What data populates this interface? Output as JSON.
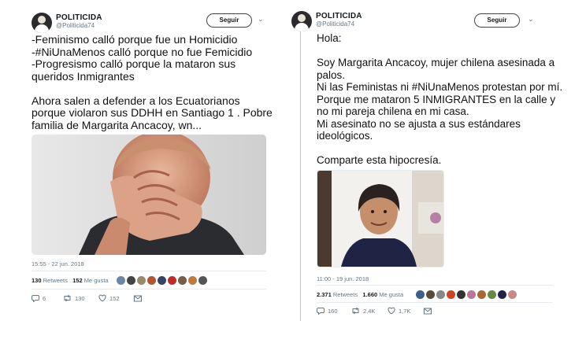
{
  "tweets": [
    {
      "name": "POLITICIDA",
      "handle": "@Politicida74",
      "follow": "Seguir",
      "text": "-Feminismo calló porque fue un Homicidio\n-#NiUnaMenos calló porque no fue Femicidio\n-Progresismo calló porque la mataron sus queridos Inmigrantes\n\nAhora salen a defender a los Ecuatorianos porque violaron sus DDHH en Santiago 1 . Pobre familia de Margarita Ancacoy, wn...",
      "time": "15:55 - 22 jun. 2018",
      "retweets_num": "130",
      "retweets_label": "Retweets",
      "likes_num": "152",
      "likes_label": "Me gusta",
      "replies": "6",
      "rt_count": "130",
      "like_count": "152",
      "face_colors": [
        "#6a86a6",
        "#444",
        "#9b8a6a",
        "#b5542e",
        "#354563",
        "#c02a2a",
        "#7a5b4a",
        "#c07a3a",
        "#555"
      ]
    },
    {
      "name": "POLITICIDA",
      "handle": "@Politicida74",
      "follow": "Seguir",
      "text": "Hola:\n\nSoy Margarita Ancacoy, mujer chilena asesinada a palos.\nNi las Feministas ni #NiUnaMenos protestan por mí.\nPorque me mataron 5 INMIGRANTES en la calle y no mi pareja chilena en mi casa.\nMi asesinato no se ajusta a sus estándares ideológicos.\n\nComparte esta hipocresía.",
      "time": "11:00 - 19 jun. 2018",
      "retweets_num": "2.371",
      "retweets_label": "Retweets",
      "likes_num": "1.660",
      "likes_label": "Me gusta",
      "replies": "160",
      "rt_count": "2,4K",
      "like_count": "1,7K",
      "face_colors": [
        "#3d5f8a",
        "#5a4a3a",
        "#888",
        "#c42",
        "#333",
        "#b79",
        "#a63",
        "#684",
        "#224",
        "#c88"
      ]
    }
  ]
}
